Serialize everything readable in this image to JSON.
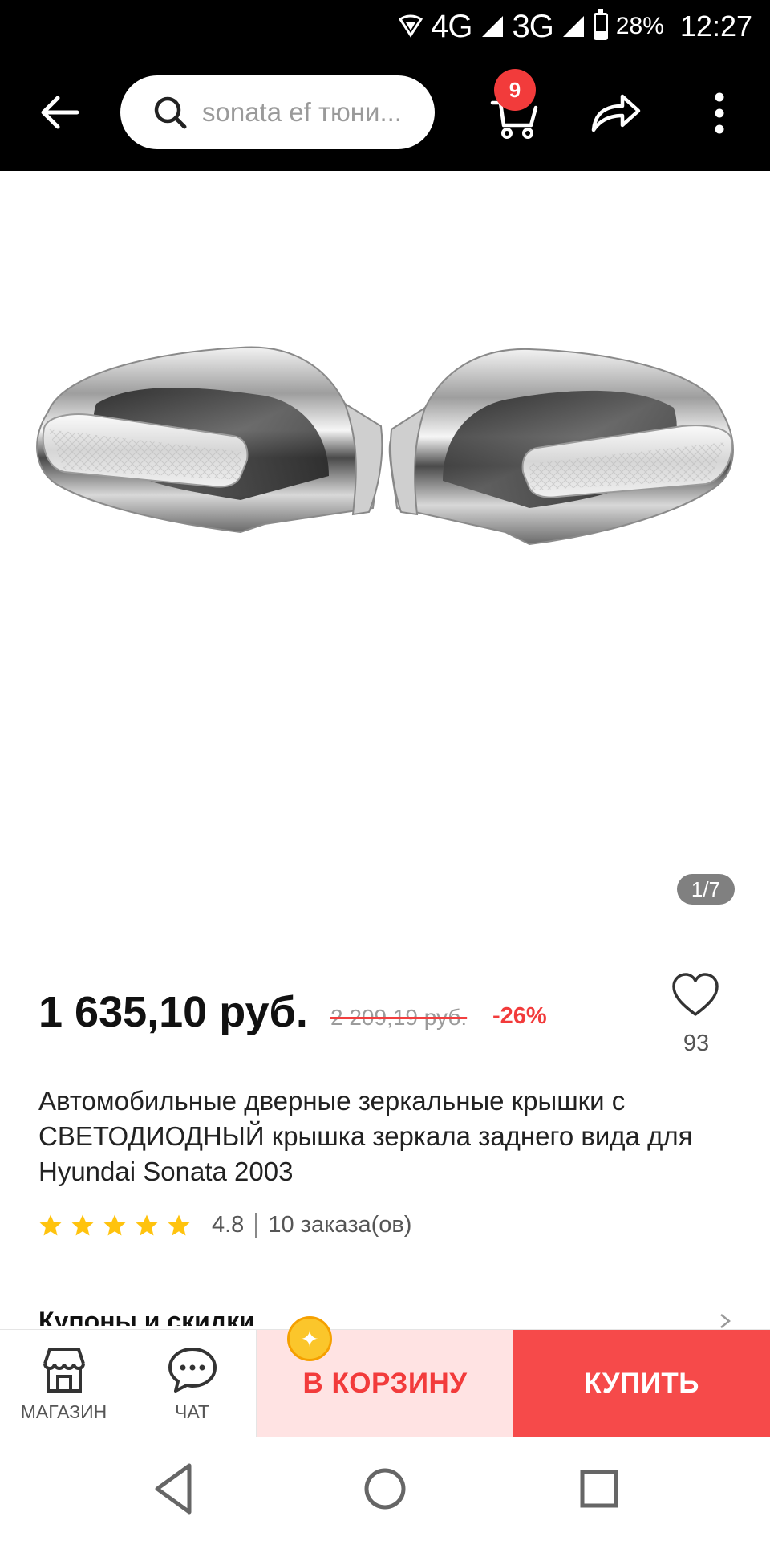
{
  "status_bar": {
    "network_4g": "4G",
    "network_3g": "3G",
    "battery": "28%",
    "battery_level": 0.28,
    "time": "12:27"
  },
  "top_bar": {
    "search_placeholder": "sonata ef тюни...",
    "cart_badge": "9"
  },
  "gallery": {
    "counter": "1/7"
  },
  "product": {
    "price": "1 635,10 руб.",
    "old_price": "2 209,19 руб.",
    "discount": "-26%",
    "wish_count": "93",
    "title": "Автомобильные дверные зеркальные крышки с СВЕТОДИОДНЫЙ крышка зеркала заднего вида для Hyundai Sonata 2003",
    "rating": "4.8",
    "rating_stars": 5,
    "orders": "10 заказа(ов)"
  },
  "coupons": {
    "label": "Купоны и скидки"
  },
  "bottom_bar": {
    "store_label": "МАГАЗИН",
    "chat_label": "ЧАТ",
    "add_to_cart": "В КОРЗИНУ",
    "buy": "КУПИТЬ"
  },
  "colors": {
    "accent_red": "#f23b3b",
    "buy_bg": "#f64a4a",
    "cart_bg": "#ffe3e3",
    "star": "#ffc30e"
  }
}
